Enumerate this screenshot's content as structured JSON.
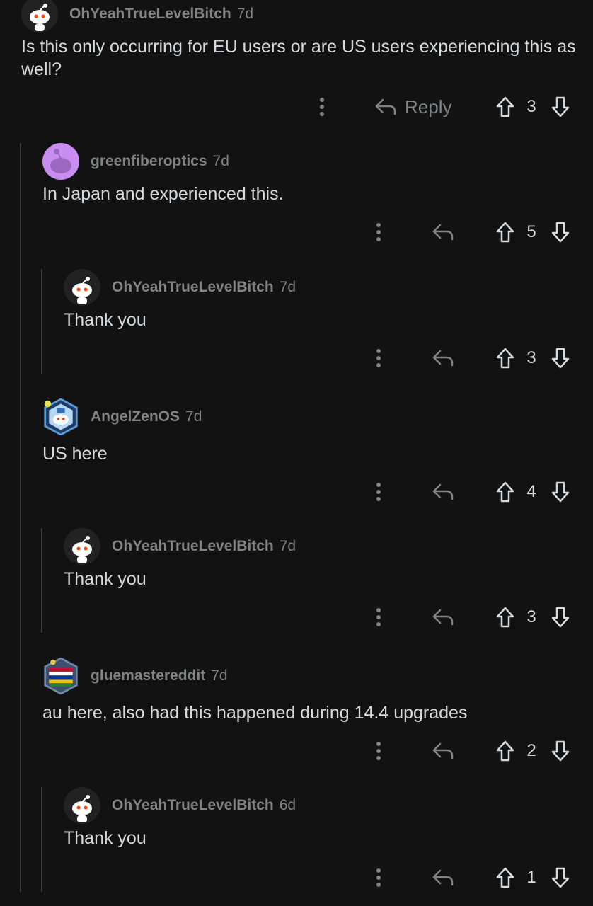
{
  "comments": [
    {
      "author": "OhYeahTrueLevelBitch",
      "time": "7d",
      "text": "Is this only occurring for EU users or are US users experiencing this as well?",
      "score": "3",
      "reply_label": "Reply",
      "avatar": "snoo-avatar"
    },
    {
      "author": "greenfiberoptics",
      "time": "7d",
      "text": "In Japan and experienced this.",
      "score": "5",
      "avatar": "default-purple-avatar"
    },
    {
      "author": "OhYeahTrueLevelBitch",
      "time": "7d",
      "text": "Thank you",
      "score": "3",
      "avatar": "snoo-avatar"
    },
    {
      "author": "AngelZenOS",
      "time": "7d",
      "text": "US here",
      "score": "4",
      "avatar": "snoo-hex-avatar"
    },
    {
      "author": "OhYeahTrueLevelBitch",
      "time": "7d",
      "text": "Thank you",
      "score": "3",
      "avatar": "snoo-avatar"
    },
    {
      "author": "gluemastereddit",
      "time": "7d",
      "text": "au here, also had this happened during 14.4 upgrades",
      "score": "2",
      "avatar": "flags-hex-avatar"
    },
    {
      "author": "OhYeahTrueLevelBitch",
      "time": "6d",
      "text": "Thank you",
      "score": "1",
      "avatar": "snoo-avatar"
    }
  ],
  "icons": {
    "more": "vertical-ellipsis-icon",
    "reply": "reply-arrow-icon",
    "upvote": "upvote-arrow-icon",
    "downvote": "downvote-arrow-icon"
  },
  "colors": {
    "background": "#121212",
    "text": "#d7dadc",
    "meta": "#818384",
    "thread_line": "#3a3a3c",
    "purple_avatar": "#c98cf0"
  }
}
